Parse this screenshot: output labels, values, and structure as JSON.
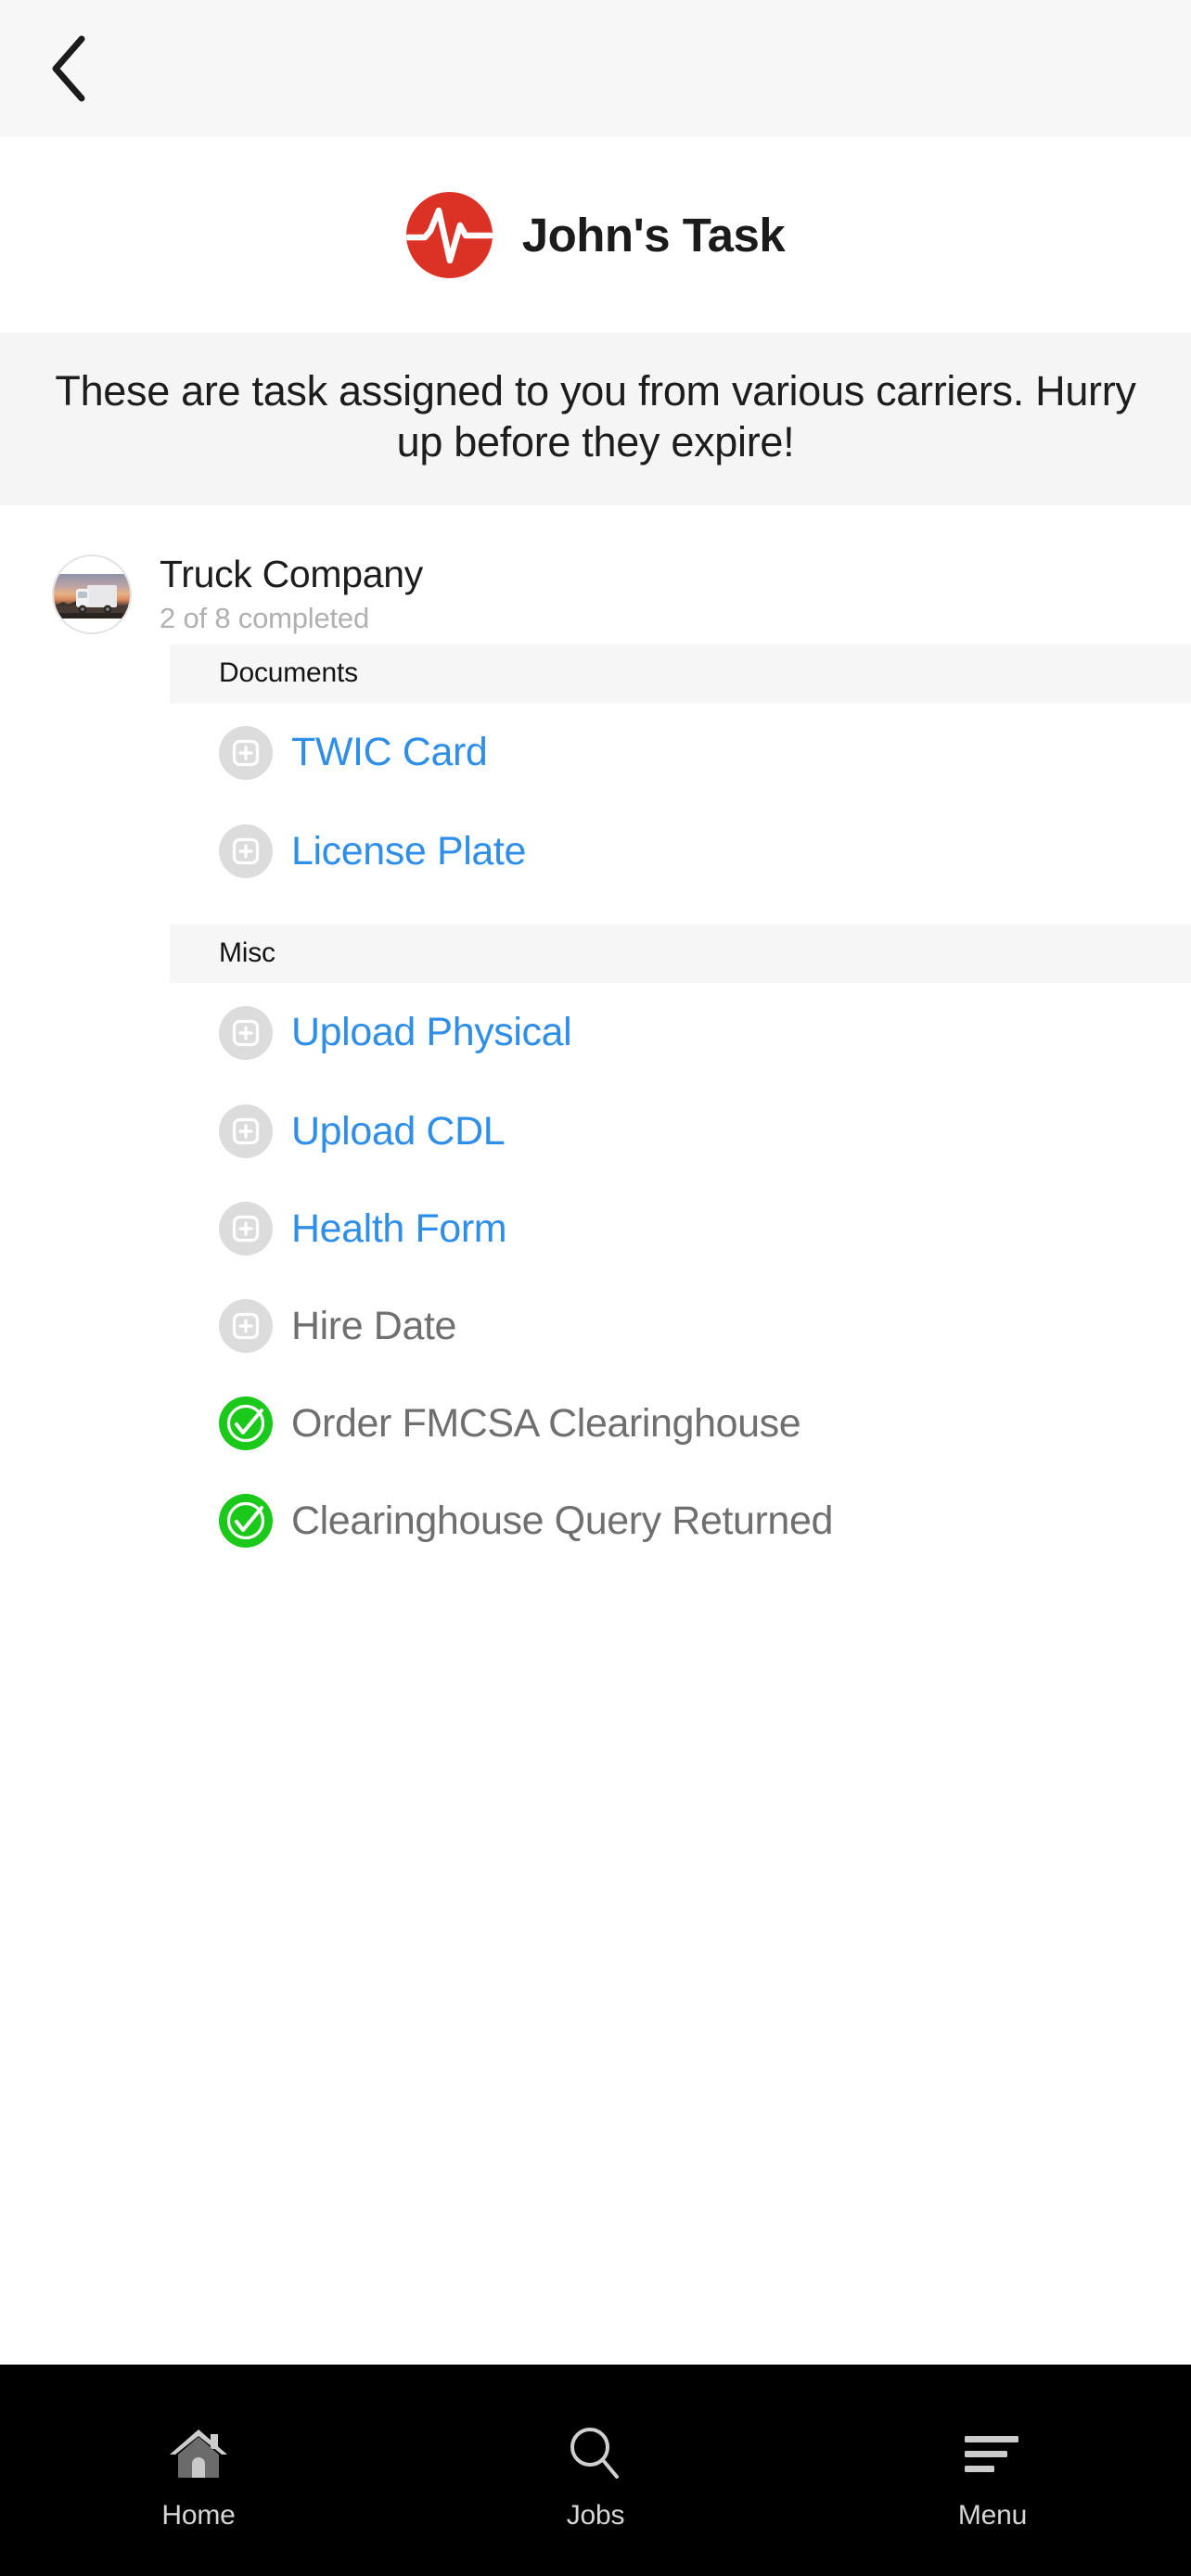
{
  "header": {
    "back_icon": "chevron-left-icon",
    "logo_icon": "heartbeat-logo-icon",
    "title": "John's Task"
  },
  "banner": {
    "text": "These are task assigned to you from various carriers. Hurry up before they expire!"
  },
  "company": {
    "avatar_icon": "truck-photo-avatar",
    "name": "Truck Company",
    "progress": "2 of 8 completed"
  },
  "sections": [
    {
      "title": "Documents",
      "items": [
        {
          "label": "TWIC Card",
          "state": "link",
          "icon": "add-plus-icon"
        },
        {
          "label": "License Plate",
          "state": "link",
          "icon": "add-plus-icon"
        }
      ]
    },
    {
      "title": "Misc",
      "items": [
        {
          "label": "Upload Physical",
          "state": "link",
          "icon": "add-plus-icon"
        },
        {
          "label": "Upload CDL",
          "state": "link",
          "icon": "add-plus-icon"
        },
        {
          "label": "Health Form",
          "state": "link",
          "icon": "add-plus-icon"
        },
        {
          "label": "Hire Date",
          "state": "muted",
          "icon": "add-plus-icon"
        },
        {
          "label": "Order FMCSA Clearinghouse",
          "state": "done",
          "icon": "check-circle-icon"
        },
        {
          "label": "Clearinghouse Query Returned",
          "state": "done",
          "icon": "check-circle-icon"
        }
      ]
    }
  ],
  "bottom_nav": [
    {
      "label": "Home",
      "icon": "home-icon"
    },
    {
      "label": "Jobs",
      "icon": "search-icon"
    },
    {
      "label": "Menu",
      "icon": "hamburger-menu-icon"
    }
  ],
  "colors": {
    "brand_red": "#dc3226",
    "link_blue": "#2f8fe8",
    "done_green": "#1ac91a",
    "muted_gray": "#6f6f6f",
    "icon_gray": "#dcdcdc",
    "banner_bg": "#f5f5f5",
    "nav_bg": "#000000"
  }
}
